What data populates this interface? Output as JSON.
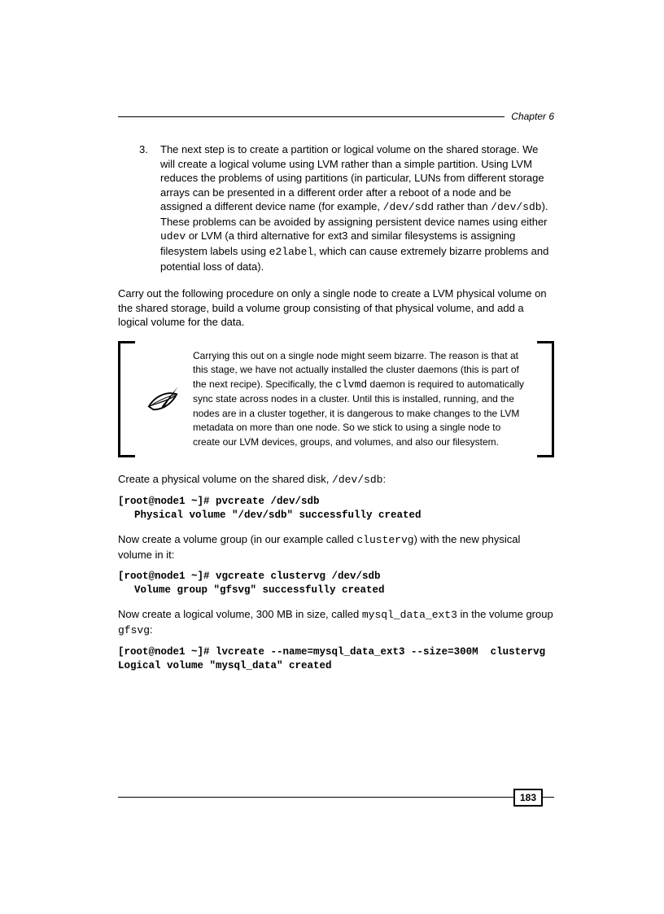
{
  "header": {
    "chapter": "Chapter 6"
  },
  "list": {
    "num": "3.",
    "p1a": "The next step is to create a partition or logical volume on the shared storage. We will create a logical volume using LVM rather than a simple partition. Using LVM reduces the problems of using partitions (in particular, LUNs from different storage arrays can be presented in a different order after a reboot of a node and be assigned a different device name (for example, ",
    "c1": "/dev/sdd",
    "p1b": " rather than ",
    "c2": "/dev/sdb",
    "p1c": "). These problems can be avoided by assigning persistent device names using either ",
    "c3": "udev",
    "p1d": " or LVM (a third alternative for ext3 and similar filesystems is assigning filesystem labels using ",
    "c4": "e2label",
    "p1e": ", which can cause extremely bizarre problems and potential loss of data)."
  },
  "para1": "Carry out the following procedure on only a single node to create a LVM physical volume on the shared storage, build a volume group consisting of that physical volume, and add a logical volume for the data.",
  "callout": {
    "t1": "Carrying this out on a single node might seem bizarre. The reason is that at this stage, we have not actually installed the cluster daemons (this is part of the next recipe). Specifically, the ",
    "c1": "clvmd",
    "t2": " daemon is required to automatically sync state across nodes in a cluster. Until this is installed, running, and the nodes are in a cluster together, it is dangerous to make changes to the LVM metadata on more than one node. So we stick to using a single node to create our LVM devices, groups, and volumes, and also our filesystem."
  },
  "para2a": "Create a physical volume on the shared disk, ",
  "para2c": "/dev/sdb",
  "para2b": ":",
  "cmd1_l1": "[root@node1 ~]# pvcreate /dev/sdb",
  "cmd1_l2": "Physical volume \"/dev/sdb\" successfully created",
  "para3a": "Now create a volume group (in our example called ",
  "para3c": "clustervg",
  "para3b": ") with the new physical volume in it:",
  "cmd2_l1": "[root@node1 ~]# vgcreate clustervg /dev/sdb",
  "cmd2_l2": "Volume group \"gfsvg\" successfully created",
  "para4a": "Now create a logical volume, 300 MB in size, called ",
  "para4c1": "mysql_data_ext3",
  "para4b": " in the volume group ",
  "para4c2": "gfsvg",
  "para4d": ":",
  "cmd3_l1": "[root@node1 ~]# lvcreate --name=mysql_data_ext3 --size=300M  clustervg",
  "cmd3_l2": "Logical volume \"mysql_data\" created",
  "footer": {
    "page": "183"
  }
}
